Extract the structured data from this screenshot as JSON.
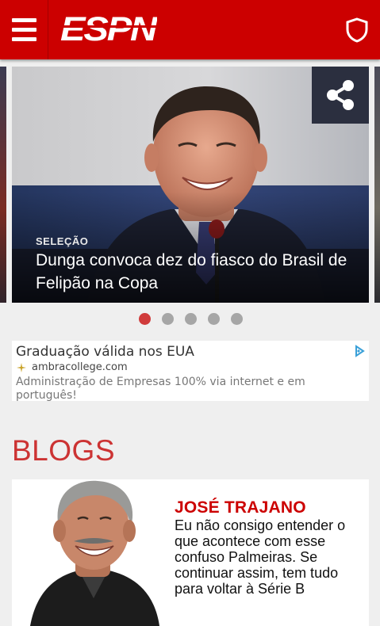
{
  "header": {
    "logo_text": "ESPN",
    "menu_icon": "hamburger-menu-icon",
    "shield_icon": "shield-icon",
    "brand_color": "#cc0000"
  },
  "carousel": {
    "kicker": "SELEÇÃO",
    "headline": "Dunga convoca dez do fiasco do Brasil de Felipão na Copa",
    "share_icon": "share-icon",
    "slide_count": 5,
    "active_index": 0
  },
  "ad": {
    "title": "Graduação válida nos EUA",
    "url": "ambracollege.com",
    "description": "Administração de Empresas 100% via internet e em português!",
    "ad_choices_icon": "ad-choices-icon"
  },
  "blogs": {
    "section_title": "BLOGS",
    "author": "JOSÉ TRAJANO",
    "text": "Eu não consigo entender o que acontece com esse confuso Palmeiras. Se continuar assim, tem tudo para voltar à Série B"
  }
}
